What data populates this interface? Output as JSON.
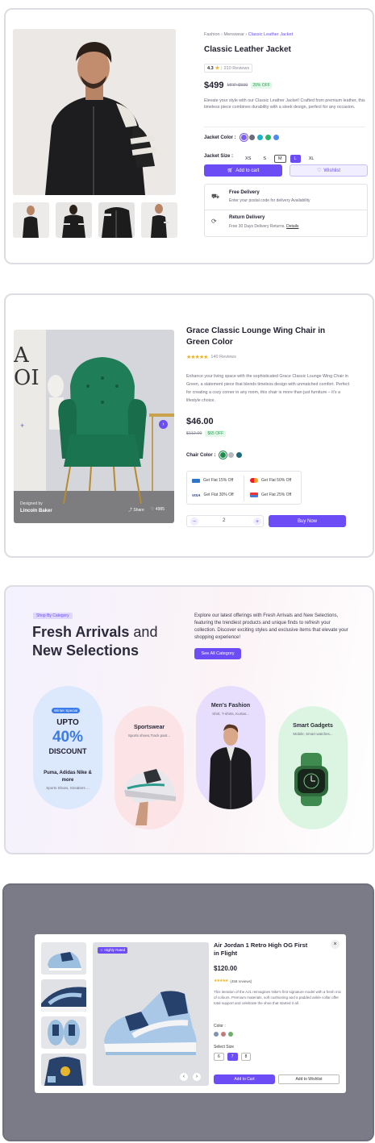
{
  "jacket": {
    "breadcrumb": [
      "Fashion",
      "Menswear",
      "Classic Leather Jacket"
    ],
    "title": "Classic Leather Jacket",
    "rating": "4.3",
    "reviews": "210 Reviews",
    "price": "$499",
    "mrp": "MRP $599",
    "discount": "20% OFF",
    "description": "Elevate your style with our Classic Leather Jacket! Crafted from premium leather, this timeless piece combines durability with a sleek design, perfect for any occasion.",
    "color_label": "Jacket Color :",
    "colors": [
      "#7b5cf5",
      "#6b6b7b",
      "#16b3c9",
      "#22b866",
      "#4a8cf0"
    ],
    "size_label": "Jacket Size :",
    "sizes": [
      "XS",
      "S",
      "M",
      "L",
      "XL"
    ],
    "selected_size": "L",
    "add_to_cart": "Add to cart",
    "wishlist": "Wishlist",
    "delivery_title": "Free Delivery",
    "delivery_sub": "Enter your postal code for delivery Availability",
    "return_title": "Return Delivery",
    "return_sub": "Free 30 Days Delivery Returns.",
    "return_link": "Details"
  },
  "chair": {
    "title": "Grace Classic Lounge Wing Chair in Green Color",
    "rating_value": 4.5,
    "reviews": "140 Reviews",
    "description": "Enhance your living space with the sophisticated Grace Classic Lounge Wing Chair in Green, a statement piece that blends timeless design with unmatched comfort. Perfect for creating a cozy corner in any room, this chair is more than just furniture – it's a lifestyle choice.",
    "price": "$46.00",
    "old_price": "$112.00",
    "save": "$65 OFF",
    "color_label": "Chair Color :",
    "colors": [
      "#1c8c4e",
      "#b8b8c0",
      "#1d6a7a"
    ],
    "offers": [
      {
        "icon": "amex-icon",
        "text": "Get Flat 15% Off"
      },
      {
        "icon": "mastercard-icon",
        "text": "Get Flat 50% Off"
      },
      {
        "icon": "visa-icon",
        "text": "Get Flat 30% Off"
      },
      {
        "icon": "card-icon",
        "text": "Get Flat 25% Off"
      }
    ],
    "quantity": "2",
    "buy_now": "Buy Now",
    "designer_label": "Designed by",
    "designer_name": "Lincoln Baker",
    "share": "Share",
    "likes": "4985"
  },
  "arrivals": {
    "badge": "Shop By Category",
    "title_bold": "Fresh Arrivals",
    "title_light": "and",
    "title_line2": "New Selections",
    "description": "Explore our latest offerings with Fresh Arrivals and New Selections, featuring the trendiest products and unique finds to refresh your collection. Discover exciting styles and exclusive items that elevate your shopping experience!",
    "button": "See All Category",
    "winter_badge": "Winter Special",
    "upto": "UPTO",
    "percent": "40%",
    "discount": "DISCOUNT",
    "brands": "Puma, Adidas Nike & more",
    "brands_sub": "Sports Shoes, Sneakers ...",
    "categories": [
      {
        "title": "Sportswear",
        "sub": "Sports shoes,Track pant..."
      },
      {
        "title": "Men's Fashion",
        "sub": "Shirt, T-shirts, Kurtas..."
      },
      {
        "title": "Smart Gadgets",
        "sub": "Mobile, Smart watches..."
      }
    ]
  },
  "sneaker": {
    "badge": "Highly Rated",
    "title": "Air Jordan 1 Retro High OG First in Flight",
    "price": "$120.00",
    "rating_value": 4.5,
    "reviews": "(458 reviews)",
    "description": "This iteration of the AJ1 reimagines Nike's first signature model with a fresh mix of colours. Premium materials, soft cushioning and a padded ankle collar offer total support and celebrate the shoe that started it all.",
    "color_label": "Color :",
    "colors": [
      "#7f93b4",
      "#c47a7a",
      "#6fae6f"
    ],
    "size_label": "Select Size",
    "sizes": [
      "6",
      "7",
      "8"
    ],
    "selected_size": "7",
    "add_to_cart": "Add to Cart",
    "wishlist": "Add to Wishlist",
    "close": "×"
  }
}
